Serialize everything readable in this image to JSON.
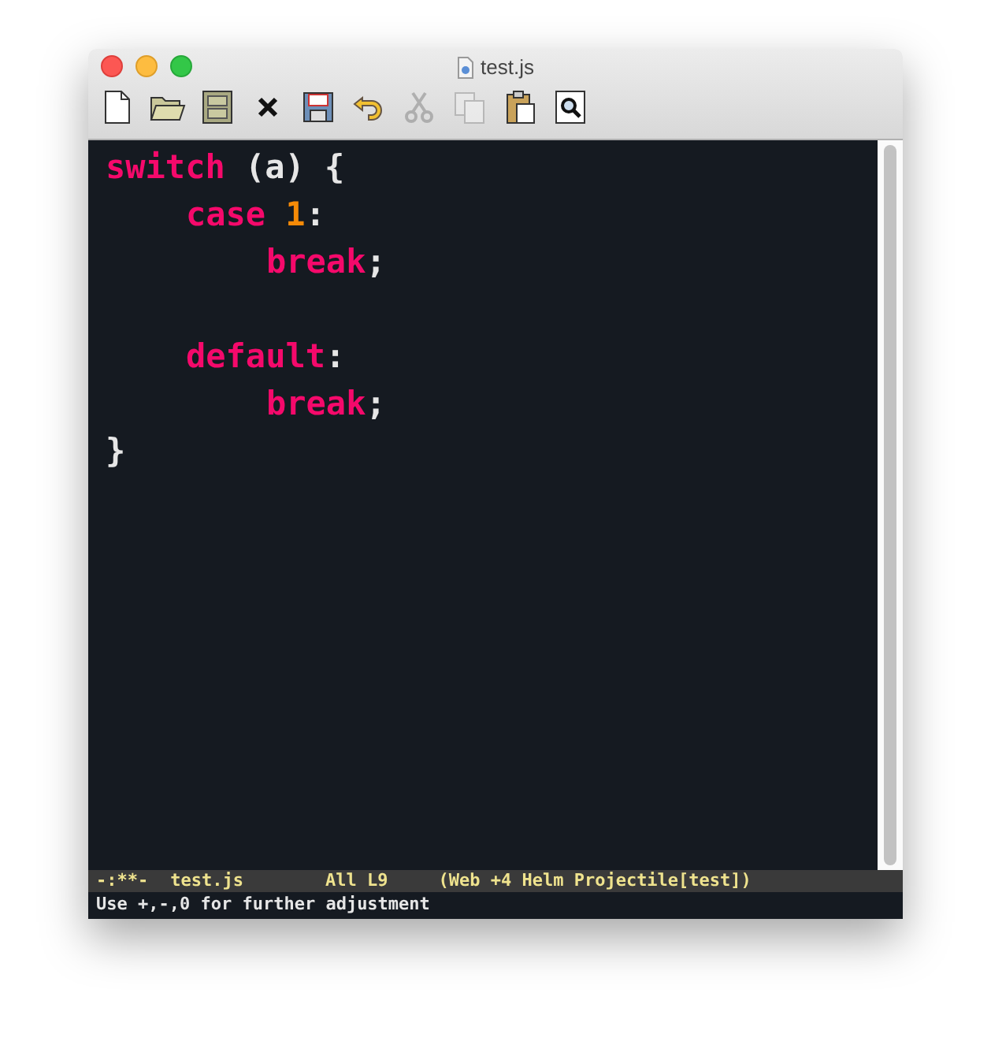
{
  "window": {
    "title": "test.js"
  },
  "toolbar": [
    {
      "kind": "new",
      "disabled": false
    },
    {
      "kind": "open",
      "disabled": false
    },
    {
      "kind": "cabinet",
      "disabled": false
    },
    {
      "kind": "close",
      "disabled": false
    },
    {
      "kind": "save",
      "disabled": false
    },
    {
      "kind": "undo",
      "disabled": false
    },
    {
      "kind": "cut",
      "disabled": true
    },
    {
      "kind": "copy",
      "disabled": true
    },
    {
      "kind": "paste",
      "disabled": false
    },
    {
      "kind": "search",
      "disabled": false
    }
  ],
  "editor": {
    "lines": [
      {
        "kind": "code",
        "tokens": [
          {
            "kind": "keyword",
            "text": "switch"
          },
          {
            "kind": "group",
            "text": "(a) {"
          }
        ],
        "children": [
          {
            "kind": "code",
            "tokens": [
              {
                "kind": "keyword",
                "text": "case"
              },
              {
                "kind": "number",
                "text": "1"
              },
              {
                "kind": "punct",
                "text": ":"
              }
            ],
            "children": [
              {
                "kind": "code",
                "tokens": [
                  {
                    "kind": "keyword",
                    "text": "break"
                  },
                  {
                    "kind": "punct",
                    "text": ";"
                  }
                ]
              }
            ]
          },
          {
            "kind": "blank"
          },
          {
            "kind": "code",
            "tokens": [
              {
                "kind": "keyword",
                "text": "default"
              },
              {
                "kind": "punct",
                "text": ":"
              }
            ],
            "children": [
              {
                "kind": "code",
                "tokens": [
                  {
                    "kind": "keyword",
                    "text": "break"
                  },
                  {
                    "kind": "punct",
                    "text": ";"
                  }
                ]
              }
            ]
          }
        ]
      },
      {
        "kind": "code",
        "tokens": [
          {
            "kind": "punct",
            "text": "}"
          }
        ]
      }
    ]
  },
  "mode_line": {
    "status": "-:**-",
    "buffer": "test.js",
    "position": "All L9",
    "modes": "(Web +4 Helm Projectile[test])"
  },
  "echo_area": {
    "message": "Use +,-,0 for further adjustment"
  }
}
